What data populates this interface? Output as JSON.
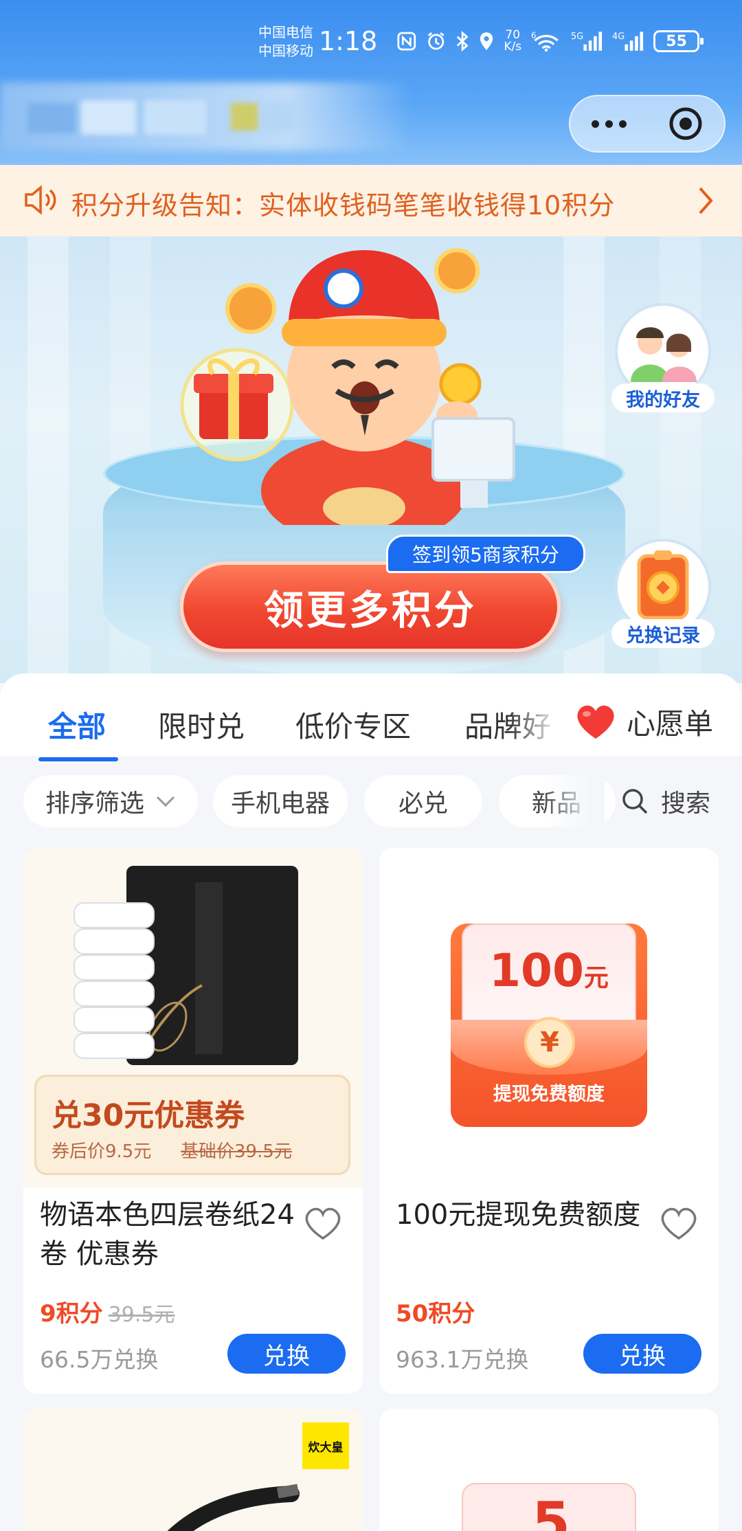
{
  "status_bar": {
    "carrier_1": "中国电信",
    "carrier_2": "中国移动",
    "time": "1:18",
    "net_speed_value": "70",
    "net_speed_unit": "K/s",
    "wifi_label": "6",
    "cell_label_1": "5G",
    "cell_label_2": "4G",
    "battery": "55"
  },
  "notice": {
    "text": "积分升级告知：实体收钱码笔笔收钱得10积分"
  },
  "hero": {
    "badge": "签到领5商家积分",
    "cta": "领更多积分",
    "friends_label": "我的好友",
    "records_label": "兑换记录"
  },
  "tabs": {
    "items": [
      "全部",
      "限时兑",
      "低价专区",
      "品牌好"
    ],
    "active": "全部",
    "wishlist": "心愿单"
  },
  "filters": {
    "sort": "排序筛选",
    "chips": [
      "手机电器",
      "必兑",
      "新品"
    ],
    "search": "搜索"
  },
  "products": [
    {
      "title": "物语本色四层卷纸24卷 优惠券",
      "coupon_title": "兑30元优惠券",
      "coupon_after": "券后价9.5元",
      "coupon_base": "基础价39.5元",
      "points": "9积分",
      "orig_price": "39.5元",
      "sold": "66.5万兑换",
      "button": "兑换"
    },
    {
      "title": "100元提现免费额度",
      "envelope_amount": "100",
      "envelope_unit": "元",
      "envelope_coin": "¥",
      "envelope_sub": "提现免费额度",
      "points": "50积分",
      "sold": "963.1万兑换",
      "button": "兑换"
    }
  ],
  "partial_cards": {
    "brand_badge": "炊大皇",
    "envelope_digit": "5"
  },
  "colors": {
    "brand_blue": "#1b6cf0",
    "points_red": "#f04a24",
    "notice_orange": "#e0601e"
  }
}
